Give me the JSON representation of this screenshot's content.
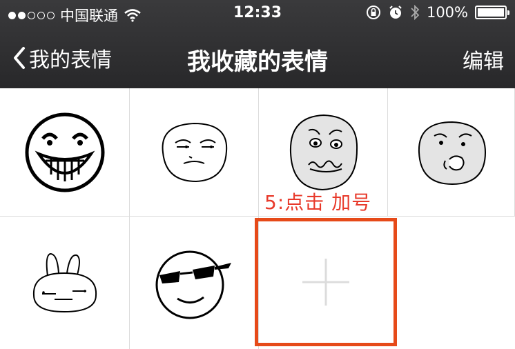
{
  "status_bar": {
    "carrier": "中国联通",
    "signal_bars_filled": 2,
    "signal_bars_total": 5,
    "time": "12:33",
    "battery": "100%",
    "battery_level": 1.0
  },
  "nav": {
    "back_label": "我的表情",
    "title": "我收藏的表情",
    "edit_label": "编辑"
  },
  "grid": {
    "items": [
      {
        "icon": "troll-grin-face-icon"
      },
      {
        "icon": "smug-face-icon"
      },
      {
        "icon": "nervous-face-icon"
      },
      {
        "icon": "nose-pick-face-icon"
      },
      {
        "icon": "bunny-face-icon"
      },
      {
        "icon": "sunglasses-face-icon"
      }
    ],
    "add_icon": "plus-icon"
  },
  "annotation": {
    "text": "5:点击  加号",
    "color": "#e8392a"
  },
  "colors": {
    "highlight": "#e64a19",
    "nav_bg": "#2e2e30"
  }
}
